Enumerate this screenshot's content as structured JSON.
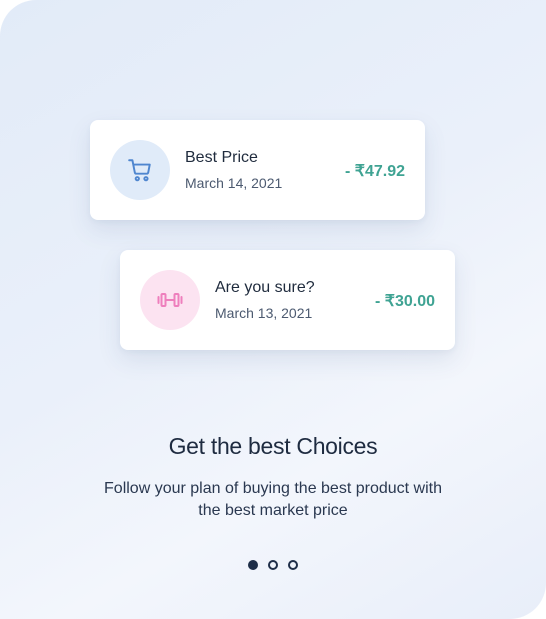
{
  "transactions": [
    {
      "icon": "shopping-cart-icon",
      "icon_color": "#4f86cf",
      "icon_bg": "#e0ebf9",
      "title": "Best Price",
      "date": "March 14, 2021",
      "amount": "- ₹47.92"
    },
    {
      "icon": "dumbbell-icon",
      "icon_color": "#ee7fbd",
      "icon_bg": "#fce3f1",
      "title": "Are you sure?",
      "date": "March 13, 2021",
      "amount": "- ₹30.00"
    }
  ],
  "onboarding": {
    "headline": "Get the best Choices",
    "subtext": "Follow your plan of buying the best product with the best market price"
  },
  "pagination": {
    "pages": 3,
    "active_index": 0
  },
  "colors": {
    "amount": "#3fa393",
    "heading": "#1e2b40",
    "dot": "#1e2e48"
  }
}
